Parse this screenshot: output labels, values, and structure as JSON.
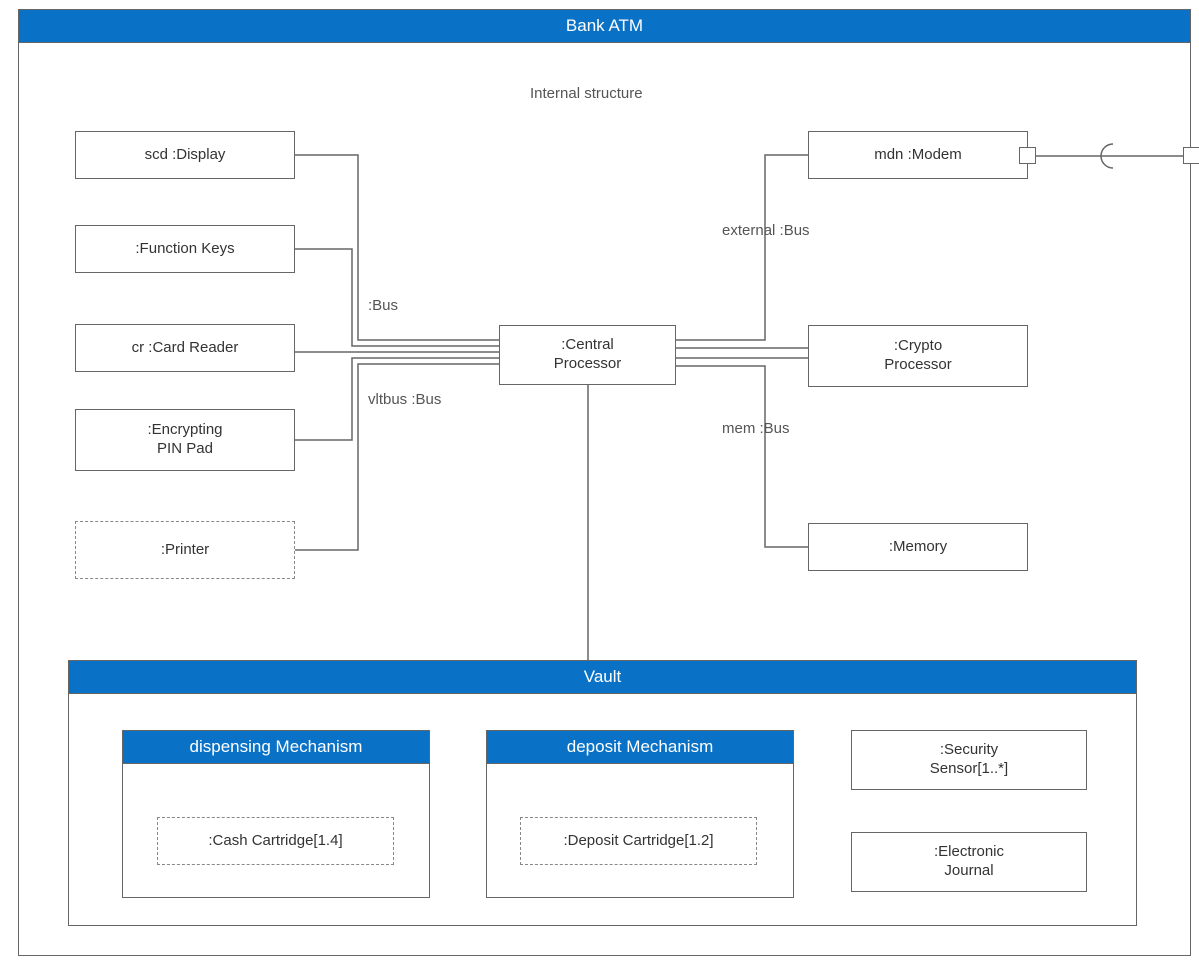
{
  "title": "Bank ATM",
  "subtitle": "Internal structure",
  "left": {
    "display": "scd :Display",
    "functionKeys": ":Function Keys",
    "cardReader": "cr :Card Reader",
    "pinPad": ":Encrypting\nPIN Pad",
    "printer": ":Printer"
  },
  "center": ":Central\nProcessor",
  "right": {
    "modem": "mdn :Modem",
    "crypto": ":Crypto\nProcessor",
    "memory": ":Memory"
  },
  "busLabels": {
    "left": ":Bus",
    "vault": "vltbus :Bus",
    "external": "external :Bus",
    "mem": "mem :Bus"
  },
  "vault": {
    "title": "Vault",
    "dispensing": {
      "title": "dispensing Mechanism",
      "cartridge": ":Cash Cartridge[1.4]"
    },
    "deposit": {
      "title": "deposit Mechanism",
      "cartridge": ":Deposit Cartridge[1.2]"
    },
    "security": ":Security\nSensor[1..*]",
    "journal": ":Electronic\nJournal"
  }
}
